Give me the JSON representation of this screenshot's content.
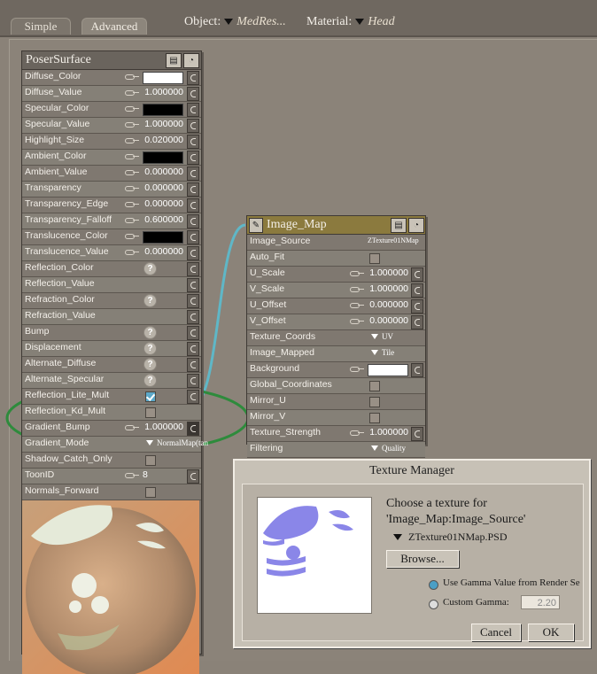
{
  "tabs": {
    "simple": "Simple",
    "advanced": "Advanced"
  },
  "header": {
    "object_label": "Object:",
    "object_value": "MedRes...",
    "material_label": "Material:",
    "material_value": "Head"
  },
  "poser_surface": {
    "title": "PoserSurface",
    "rows": {
      "diffuse_color": "Diffuse_Color",
      "diffuse_value": "Diffuse_Value",
      "diffuse_value_num": "1.000000",
      "specular_color": "Specular_Color",
      "specular_value": "Specular_Value",
      "specular_value_num": "1.000000",
      "highlight_size": "Highlight_Size",
      "highlight_size_num": "0.020000",
      "ambient_color": "Ambient_Color",
      "ambient_value": "Ambient_Value",
      "ambient_value_num": "0.000000",
      "transparency": "Transparency",
      "transparency_num": "0.000000",
      "transparency_edge": "Transparency_Edge",
      "transparency_edge_num": "0.000000",
      "transparency_falloff": "Transparency_Falloff",
      "transparency_falloff_num": "0.600000",
      "translucence_color": "Translucence_Color",
      "translucence_value": "Translucence_Value",
      "translucence_value_num": "0.000000",
      "reflection_color": "Reflection_Color",
      "reflection_value": "Reflection_Value",
      "refraction_color": "Refraction_Color",
      "refraction_value": "Refraction_Value",
      "bump": "Bump",
      "displacement": "Displacement",
      "alternate_diffuse": "Alternate_Diffuse",
      "alternate_specular": "Alternate_Specular",
      "reflection_lite_mult": "Reflection_Lite_Mult",
      "reflection_kd_mult": "Reflection_Kd_Mult",
      "gradient_bump": "Gradient_Bump",
      "gradient_bump_num": "1.000000",
      "gradient_mode": "Gradient_Mode",
      "gradient_mode_value": "NormalMap(tan",
      "shadow_catch_only": "Shadow_Catch_Only",
      "toon_id": "ToonID",
      "toon_id_num": "8",
      "normals_forward": "Normals_Forward"
    }
  },
  "image_map": {
    "title": "Image_Map",
    "rows": {
      "image_source": "Image_Source",
      "image_source_value": "ZTexture01NMap",
      "auto_fit": "Auto_Fit",
      "u_scale": "U_Scale",
      "u_scale_num": "1.000000",
      "v_scale": "V_Scale",
      "v_scale_num": "1.000000",
      "u_offset": "U_Offset",
      "u_offset_num": "0.000000",
      "v_offset": "V_Offset",
      "v_offset_num": "0.000000",
      "texture_coords": "Texture_Coords",
      "texture_coords_value": "UV",
      "image_mapped": "Image_Mapped",
      "image_mapped_value": "Tile",
      "background": "Background",
      "global_coordinates": "Global_Coordinates",
      "mirror_u": "Mirror_U",
      "mirror_v": "Mirror_V",
      "texture_strength": "Texture_Strength",
      "texture_strength_num": "1.000000",
      "filtering": "Filtering",
      "filtering_value": "Quality"
    }
  },
  "texture_manager": {
    "title": "Texture Manager",
    "choose_line1": "Choose a texture for",
    "choose_line2": "'Image_Map:Image_Source'",
    "file": "ZTexture01NMap.PSD",
    "browse": "Browse...",
    "use_gamma": "Use Gamma Value from Render Se",
    "custom_gamma": "Custom Gamma:",
    "gamma_value": "2.20",
    "cancel": "Cancel",
    "ok": "OK"
  },
  "colors": {
    "node_link": "#5fb7c7",
    "highlight_ellipse": "#2e8b3c",
    "normal_map_blue": "#8a86e8"
  }
}
